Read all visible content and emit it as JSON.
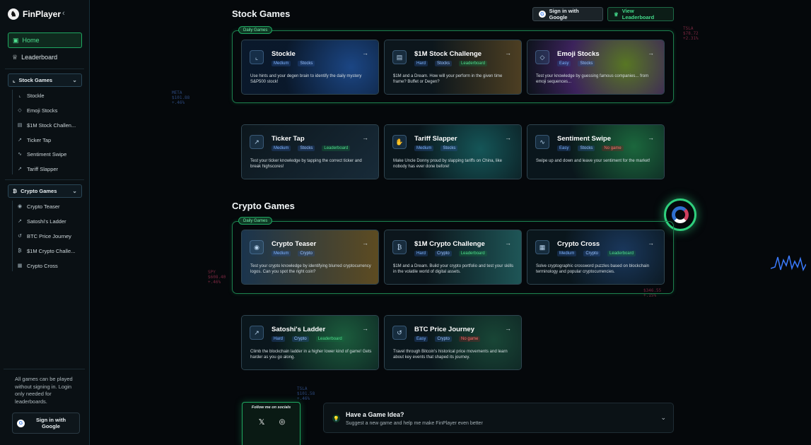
{
  "brand": {
    "name": "FinPlayer",
    "logo_icon": "finplayer-logo-icon"
  },
  "sidebar": {
    "home": "Home",
    "leaderboard": "Leaderboard",
    "stock_group": {
      "label": "Stock Games",
      "items": [
        "Stockle",
        "Emoji Stocks",
        "$1M Stock Challen...",
        "Ticker Tap",
        "Sentiment Swipe",
        "Tariff Slapper"
      ]
    },
    "crypto_group": {
      "label": "Crypto Games",
      "items": [
        "Crypto Teaser",
        "Satoshi's Ladder",
        "BTC Price Journey",
        "$1M Crypto Challe...",
        "Crypto Cross"
      ]
    },
    "note": "All games can be played without signing in. Login only needed for leaderboards.",
    "signin": "Sign in with Google"
  },
  "header": {
    "signin": "Sign in with Google",
    "view_leaderboard": "View Leaderboard"
  },
  "sections": {
    "stock_title": "Stock Games",
    "crypto_title": "Crypto Games",
    "daily_label": "Daily Games"
  },
  "stock_cards": [
    {
      "title": "Stockle",
      "tags": [
        "Medium",
        "Stocks"
      ],
      "desc": "Use hints and your degen brain to identify the daily mystery S&P500 stock!"
    },
    {
      "title": "$1M Stock Challenge",
      "tags": [
        "Hard",
        "Stocks",
        "Leaderboard"
      ],
      "desc": "$1M and a Dream. How will your perform in the given time frame? Buffet or Degen?"
    },
    {
      "title": "Emoji Stocks",
      "tags": [
        "Easy",
        "Stocks"
      ],
      "desc": "Test your knowledge by guessing famous companies... from emoji sequences..."
    },
    {
      "title": "Ticker Tap",
      "tags": [
        "Medium",
        "Stocks",
        "Leaderboard"
      ],
      "desc": "Test your ticker knowledge by tapping the correct ticker and break highscores!"
    },
    {
      "title": "Tariff Slapper",
      "tags": [
        "Medium",
        "Stocks"
      ],
      "desc": "Make Uncle Donny proud by slapping tariffs on China, like nobody has ever done before!"
    },
    {
      "title": "Sentiment Swipe",
      "tags": [
        "Easy",
        "Stocks",
        "No game"
      ],
      "desc": "Swipe up and down and leave your sentiment for the market!"
    }
  ],
  "crypto_cards": [
    {
      "title": "Crypto Teaser",
      "tags": [
        "Medium",
        "Crypto"
      ],
      "desc": "Test your crypto knowledge by identifying blurred cryptocurrency logos. Can you spot the right coin?"
    },
    {
      "title": "$1M Crypto Challenge",
      "tags": [
        "Hard",
        "Crypto",
        "Leaderboard"
      ],
      "desc": "$1M and a Dream. Build your crypto portfolio and test your skills in the volatile world of digital assets."
    },
    {
      "title": "Crypto Cross",
      "tags": [
        "Medium",
        "Crypto",
        "Leaderboard"
      ],
      "desc": "Solve cryptographic crossword puzzles based on blockchain terminology and popular cryptocurrencies."
    },
    {
      "title": "Satoshi's Ladder",
      "tags": [
        "Hard",
        "Crypto",
        "Leaderboard"
      ],
      "desc": "Climb the blockchain ladder in a higher lower kind of game! Gets harder as you go along."
    },
    {
      "title": "BTC Price Journey",
      "tags": [
        "Easy",
        "Crypto",
        "No game"
      ],
      "desc": "Travel through Bitcoin's historical price movements and learn about key events that shaped its journey."
    }
  ],
  "footer": {
    "follow_label": "Follow me on socials",
    "idea_title": "Have a Game Idea?",
    "idea_sub": "Suggest a new game and help me make FinPlayer even better"
  },
  "colors": {
    "accent_green": "#1fa861",
    "bg": "#05080b",
    "tag_blue": "#7fb4ff",
    "tag_red": "#ff6b6b"
  }
}
